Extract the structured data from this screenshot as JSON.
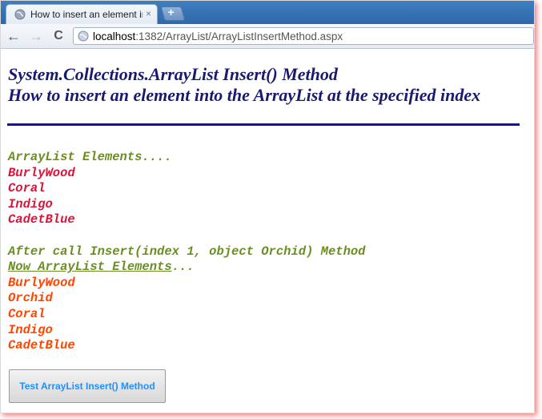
{
  "browser": {
    "tab_title": "How to insert an element in",
    "tab_close": "×",
    "new_tab": "+",
    "url_host": "localhost",
    "url_rest": ":1382/ArrayList/ArrayListInsertMethod.aspx",
    "back_glyph": "←",
    "forward_glyph": "→",
    "reload_glyph": "C"
  },
  "page": {
    "heading_line1": "System.Collections.ArrayList Insert() Method",
    "heading_line2": "How to insert an element into the ArrayList at the specified index",
    "initial_label": "ArrayList Elements....",
    "initial_items": [
      "BurlyWood",
      "Coral",
      "Indigo",
      "CadetBlue"
    ],
    "after_label": "After call Insert(index 1, object Orchid) Method",
    "now_label_underlined": "Now ArrayList Elements",
    "now_label_suffix": "...",
    "final_items": [
      "BurlyWood",
      "Orchid",
      "Coral",
      "Indigo",
      "CadetBlue"
    ],
    "button_label": "Test ArrayList Insert() Method"
  },
  "colors": {
    "heading": "#191970",
    "label": "#6b8e23",
    "initial_items": "#dc143c",
    "final_items": "#ff4500",
    "button_text": "#1e90ff"
  }
}
